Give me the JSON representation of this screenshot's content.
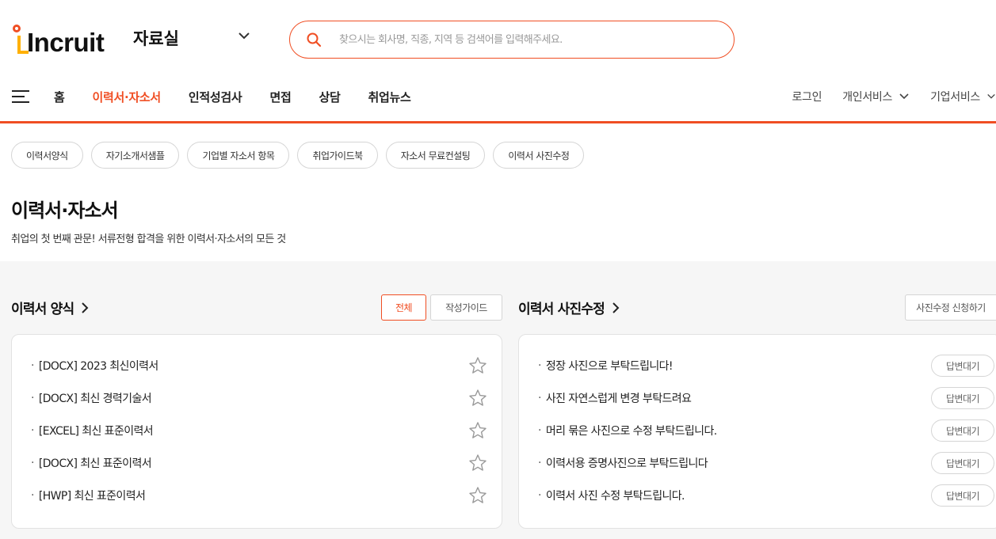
{
  "brand": {
    "logo_text": "Incruit",
    "section": "자료실"
  },
  "search": {
    "placeholder": "찾으시는 회사명, 직종, 지역 등 검색어를 입력해주세요."
  },
  "nav": {
    "items": [
      {
        "label": "홈",
        "active": false
      },
      {
        "label": "이력서·자소서",
        "active": true
      },
      {
        "label": "인적성검사",
        "active": false
      },
      {
        "label": "면접",
        "active": false
      },
      {
        "label": "상담",
        "active": false
      },
      {
        "label": "취업뉴스",
        "active": false
      }
    ],
    "login": "로그인",
    "personal": "개인서비스",
    "corporate": "기업서비스"
  },
  "chips": [
    "이력서양식",
    "자기소개서샘플",
    "기업별 자소서 항목",
    "취업가이드북",
    "자소서 무료컨설팅",
    "이력서 사진수정"
  ],
  "page": {
    "title": "이력서·자소서",
    "subtitle": "취업의 첫 번째 관문! 서류전형 합격을 위한 이력서·자소서의 모든 것"
  },
  "resume_panel": {
    "title": "이력서 양식",
    "tab_all": "전체",
    "tab_guide": "작성가이드",
    "items": [
      "[DOCX] 2023 최신이력서",
      "[DOCX] 최신 경력기술서",
      "[EXCEL] 최신 표준이력서",
      "[DOCX] 최신 표준이력서",
      "[HWP] 최신 표준이력서"
    ]
  },
  "photo_panel": {
    "title": "이력서 사진수정",
    "apply_button": "사진수정 신청하기",
    "items": [
      {
        "text": "정장 사진으로 부탁드립니다!",
        "status": "답변대기"
      },
      {
        "text": "사진 자연스럽게 변경 부탁드려요",
        "status": "답변대기"
      },
      {
        "text": "머리 묶은 사진으로 수정 부탁드립니다.",
        "status": "답변대기"
      },
      {
        "text": "이력서용 증명사진으로 부탁드립니다",
        "status": "답변대기"
      },
      {
        "text": "이력서 사진 수정 부탁드립니다.",
        "status": "답변대기"
      }
    ]
  },
  "colors": {
    "accent": "#f04e23",
    "logo_yellow": "#ffb000"
  }
}
